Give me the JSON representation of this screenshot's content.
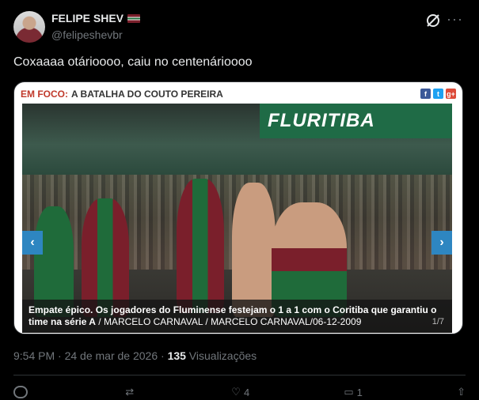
{
  "author": {
    "display_name": "FELIPE SHEV",
    "handle": "@felipeshevbr",
    "flag_icon": "fluminense-flag-icon"
  },
  "tweet": {
    "text": "Coxaaaa otárioooo, caiu no centenárioooo"
  },
  "media": {
    "header_kicker": "EM FOCO:",
    "header_title": "A BATALHA DO COUTO PEREIRA",
    "banner_text": "FLURITIBA",
    "share_icons": [
      "f",
      "t",
      "g+"
    ],
    "caption_bold": "Empate épico. Os jogadores do Fluminense festejam o 1 a 1 com o Coritiba que garantiu o time na série A",
    "caption_credit": " / MARCELO CARNAVAL / MARCELO CARNAVAL/06-12-2009",
    "counter": "1/7",
    "prev_arrow": "‹",
    "next_arrow": "›"
  },
  "meta": {
    "time": "9:54 PM · 24 de mar de 2026 · ",
    "views_count": "135",
    "views_label": " Visualizações"
  },
  "actions": {
    "reply_count": "",
    "retweet_count": "",
    "like_count": "4",
    "bookmark_count": "1"
  },
  "colors": {
    "background": "#000000",
    "text": "#e7e9ea",
    "muted": "#71767b",
    "accent_blue": "#2e86c1"
  }
}
